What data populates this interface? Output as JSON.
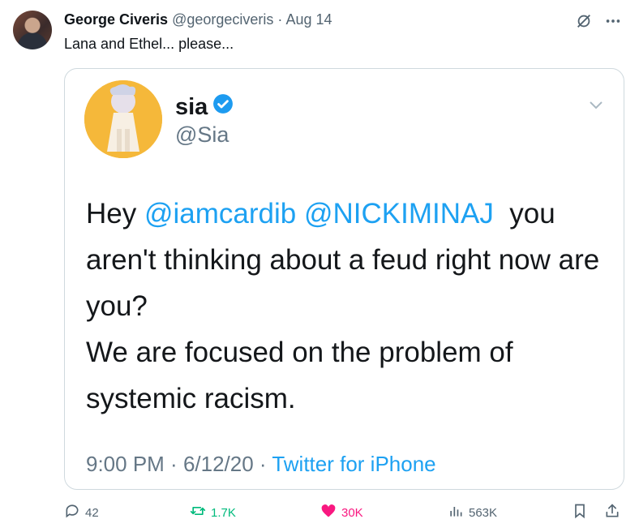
{
  "tweet": {
    "author_name": "George Civeris",
    "author_handle": "@georgeciveris",
    "separator": "·",
    "date": "Aug 14",
    "text": "Lana and Ethel... please..."
  },
  "embedded": {
    "name": "sia",
    "handle": "@Sia",
    "body": {
      "line1_prefix": "Hey ",
      "mention1": "@iamcardib",
      "space": " ",
      "mention2": "@NICKIMINAJ",
      "line1_suffix": "  you aren't thinking about a feud right now are you?",
      "line2": "We are focused on the problem of systemic racism."
    },
    "time": "9:00 PM",
    "sep": " · ",
    "date": "6/12/20",
    "source": "Twitter for iPhone"
  },
  "actions": {
    "replies": "42",
    "retweets": "1.7K",
    "likes": "30K",
    "views": "563K"
  },
  "colors": {
    "retweet": "#00ba7c",
    "like": "#f91880",
    "mention": "#1da1f2",
    "muted": "#536471"
  }
}
